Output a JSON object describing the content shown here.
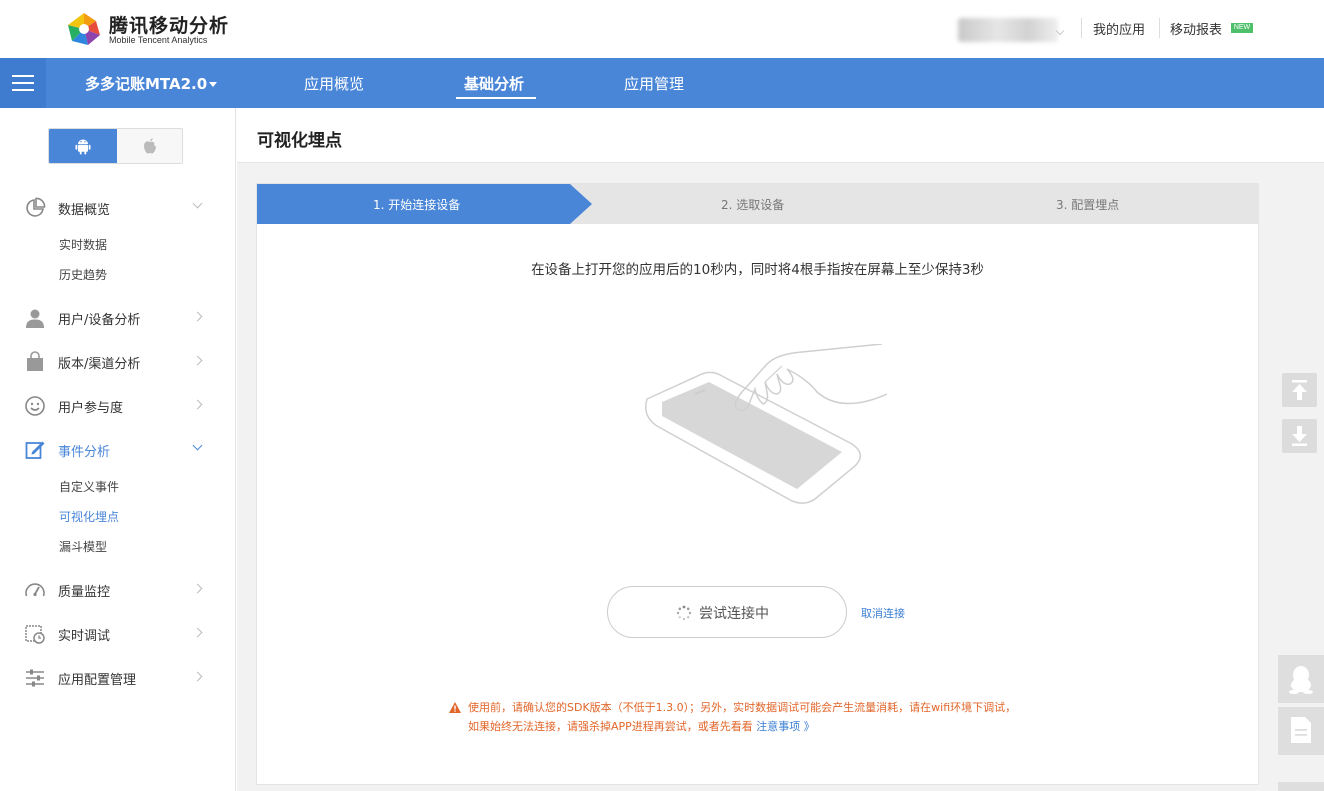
{
  "header": {
    "logo_title": "腾讯移动分析",
    "logo_subtitle": "Mobile Tencent Analytics",
    "my_apps": "我的应用",
    "mobile_reports": "移动报表",
    "new_badge": "NEW"
  },
  "nav": {
    "app_name": "多多记账MTA2.0",
    "items": [
      "应用概览",
      "基础分析",
      "应用管理"
    ],
    "active": "基础分析"
  },
  "sidebar": {
    "groups": [
      {
        "label": "数据概览",
        "icon": "pie-chart-icon",
        "expanded": true,
        "subs": [
          "实时数据",
          "历史趋势"
        ]
      },
      {
        "label": "用户/设备分析",
        "icon": "user-icon"
      },
      {
        "label": "版本/渠道分析",
        "icon": "bag-icon"
      },
      {
        "label": "用户参与度",
        "icon": "smile-icon"
      },
      {
        "label": "事件分析",
        "icon": "edit-icon",
        "expanded": true,
        "subs": [
          "自定义事件",
          "可视化埋点",
          "漏斗模型"
        ]
      },
      {
        "label": "质量监控",
        "icon": "gauge-icon"
      },
      {
        "label": "实时调试",
        "icon": "calendar-clock-icon"
      },
      {
        "label": "应用配置管理",
        "icon": "sliders-icon"
      }
    ],
    "active_sub": "可视化埋点"
  },
  "page": {
    "title": "可视化埋点",
    "steps": [
      "1. 开始连接设备",
      "2. 选取设备",
      "3. 配置埋点"
    ],
    "active_step": 0,
    "instruction": "在设备上打开您的应用后的10秒内，同时将4根手指按在屏幕上至少保持3秒",
    "connect_button": "尝试连接中",
    "cancel_link": "取消连接",
    "warning_line1": "使用前，请确认您的SDK版本（不低于1.3.0）；另外，实时数据调试可能会产生流量消耗，请在wifi环境下调试，",
    "warning_line2": "如果始终无法连接，请强杀掉APP进程再尝试，或者先看看",
    "warning_link": "注意事项 》"
  },
  "colors": {
    "primary": "#4a86d8",
    "warning": "#e2662a",
    "link": "#3b7fd3",
    "new_badge": "#4ec06a"
  }
}
